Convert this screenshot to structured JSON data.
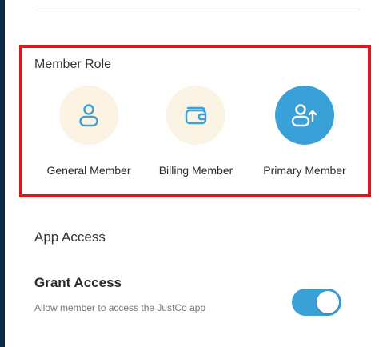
{
  "colors": {
    "accent": "#3aa0d8",
    "highlight_border": "#e0141e",
    "inactive_circle": "#fbf3e4",
    "left_bar": "#0b2a4a"
  },
  "member_role": {
    "title": "Member Role",
    "options": [
      {
        "label": "General Member",
        "icon": "person-icon",
        "selected": false
      },
      {
        "label": "Billing Member",
        "icon": "wallet-icon",
        "selected": false
      },
      {
        "label": "Primary Member",
        "icon": "person-arrow-up-icon",
        "selected": true
      }
    ]
  },
  "app_access": {
    "section_title": "App Access",
    "grant_title": "Grant Access",
    "grant_description": "Allow member to access the JustCo app",
    "toggle_on": true
  }
}
